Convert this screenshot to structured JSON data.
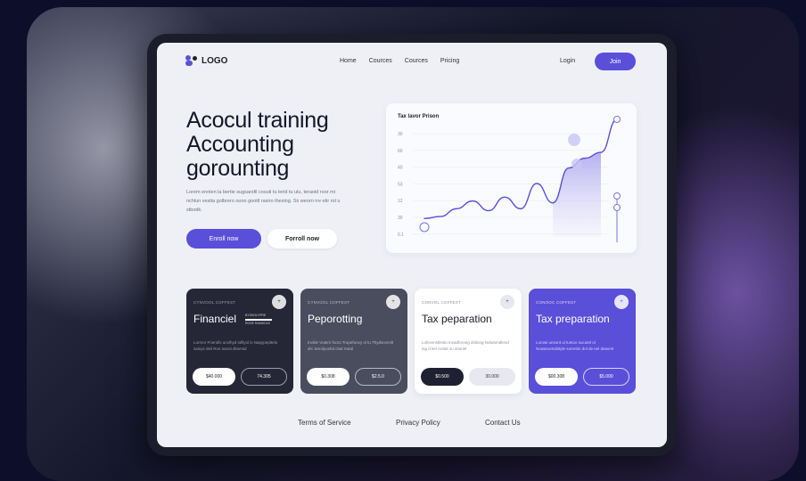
{
  "nav": {
    "logo": "LOGO",
    "links": [
      "Home",
      "Cources",
      "Cources",
      "Pricing"
    ],
    "login": "Login",
    "join": "Join"
  },
  "hero": {
    "title_lines": [
      "Acocul training",
      "Accounting",
      "gorounting"
    ],
    "description": "Lorem ennlen la bertie sugsarsfil cosuti tu lerid tu ulu, teraoid roor mi nchlun vesita golbrero ouno gooitl rasiro thesing. Siı weorn rre etir rol u stbodk.",
    "enroll_label": "Enroll now",
    "enroll2_label": "Forroll now"
  },
  "chart": {
    "title": "Tax lavor Prison",
    "y_ticks": [
      "30",
      "60",
      "40",
      "53",
      "12",
      "30",
      "0.1"
    ]
  },
  "chart_data": {
    "type": "area",
    "title": "Tax lavor Prison",
    "ylabel": "",
    "xlabel": "",
    "y_ticks": [
      "30",
      "60",
      "40",
      "53",
      "12",
      "30",
      "0.1"
    ],
    "x": [
      0,
      1,
      2,
      3,
      4,
      5,
      6,
      7,
      8,
      9,
      10,
      11,
      12
    ],
    "values": [
      4,
      5,
      9,
      13,
      8,
      15,
      9,
      22,
      12,
      30,
      35,
      38,
      55
    ],
    "colors": {
      "line": "#5a4fd8",
      "fill": "#b9b3f0"
    }
  },
  "cards": [
    {
      "tag": "CYNVOOL COFFEST",
      "dot": "+",
      "title": "Financiel",
      "mini": [
        "BYSSOLYPRE",
        "ROSE RAMSOLE"
      ],
      "description": "Lormor Fnerolls unclhyd tolllyol is Napypepttelo saluys deil Ros Ivurut dlovnsd",
      "btn1": "$40.000",
      "btn2": "74.305",
      "colors": {
        "bg": "#262736",
        "fg": "#ffffff",
        "muted": "#9a9cac"
      }
    },
    {
      "tag": "CYNVOOL COFFEST",
      "dot": "+",
      "title": "Peporotting",
      "description": "Invlde Vutem fooro Trupefonvy ol tu Thydscemilt drc Serolyoshd clad Sotal",
      "btn1": "$0.308",
      "btn2": "$2.5.0",
      "colors": {
        "bg": "#4a4d5e",
        "fg": "#ffffff",
        "muted": "#b7b9c6"
      }
    },
    {
      "tag": "CONVOL COFFEST",
      "dot": "+",
      "title": "Tax peparation",
      "description": "Lolnvenstlesto Invadforoeg dstlong Nolwsmdlend ing d lert ronlal ou dosriel",
      "btn1": "$0.500",
      "btn2": "30.000",
      "colors": {
        "bg": "#ffffff",
        "fg": "#1a1b28",
        "muted": "#8e90a0"
      }
    },
    {
      "tag": "CONOOC COFFEST",
      "dot": "+",
      "title": "Tax preparation",
      "description": "Lorowi unsont ul tuntoo sucutel ol Nowanomsibtyle sorretim dol de eel deavrel",
      "btn1": "$00.308",
      "btn2": "$5.000",
      "colors": {
        "bg": "#5a4fd8",
        "fg": "#ffffff",
        "muted": "#d7d3fa"
      }
    }
  ],
  "footer": {
    "links": [
      "Terms of Service",
      "Privacy Policy",
      "Contact Us"
    ]
  }
}
